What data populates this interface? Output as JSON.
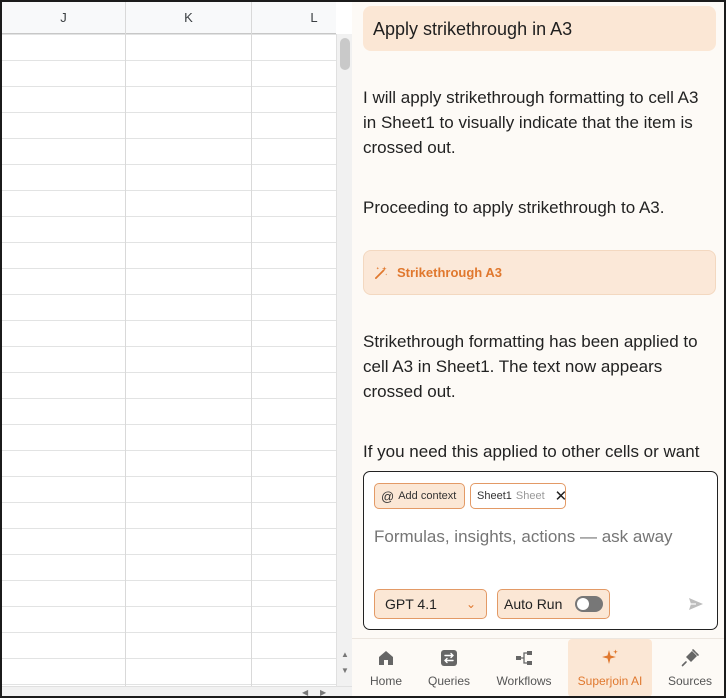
{
  "sheet": {
    "columns": [
      "J",
      "K",
      "L"
    ]
  },
  "chat": {
    "user_message": "Apply strikethrough in A3",
    "assistant_1": "I will apply strikethrough formatting to cell A3 in Sheet1 to visually indicate that the item is crossed out.",
    "assistant_2": "Proceeding to apply strikethrough to A3.",
    "tool_action": "Strikethrough A3",
    "assistant_3": "Strikethrough formatting has been applied to cell A3 in Sheet1. The text now appears crossed out.",
    "assistant_4": "If you need this applied to other cells or want"
  },
  "composer": {
    "add_context_label": "Add context",
    "context_chip_name": "Sheet1",
    "context_chip_type": "Sheet",
    "placeholder": "Formulas, insights, actions — ask away",
    "model": "GPT 4.1",
    "autorun_label": "Auto Run",
    "autorun_enabled": false
  },
  "nav": {
    "items": [
      {
        "label": "Home",
        "icon": "home-icon"
      },
      {
        "label": "Queries",
        "icon": "swap-icon"
      },
      {
        "label": "Workflows",
        "icon": "workflow-icon"
      },
      {
        "label": "Superjoin AI",
        "icon": "sparkle-icon",
        "active": true
      },
      {
        "label": "Sources",
        "icon": "plug-icon"
      }
    ]
  },
  "colors": {
    "accent": "#e0782e",
    "accent_soft": "#fbe7d5",
    "panel_bg": "#fdfaf6"
  }
}
